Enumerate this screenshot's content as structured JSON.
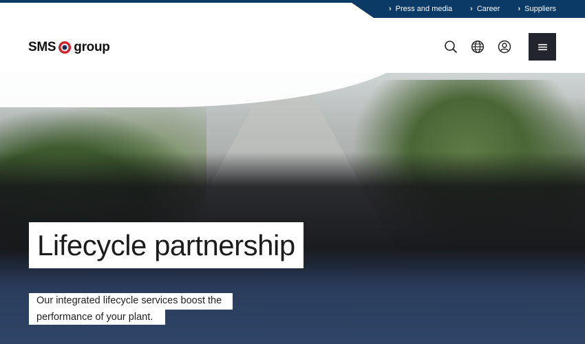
{
  "topbar": {
    "links": [
      {
        "label": "Press and media"
      },
      {
        "label": "Career"
      },
      {
        "label": "Suppliers"
      }
    ]
  },
  "header": {
    "logo": {
      "left": "SMS",
      "right": "group"
    },
    "icons": [
      "search-icon",
      "globe-icon",
      "account-icon",
      "menu-icon"
    ]
  },
  "hero": {
    "headline": "Lifecycle partnership",
    "subline_1": "Our integrated lifecycle services boost the",
    "subline_2": "performance of your plant."
  },
  "colors": {
    "brand_navy": "#0b3a66",
    "menu_button": "#22252d",
    "logo_red": "#d2232a"
  }
}
